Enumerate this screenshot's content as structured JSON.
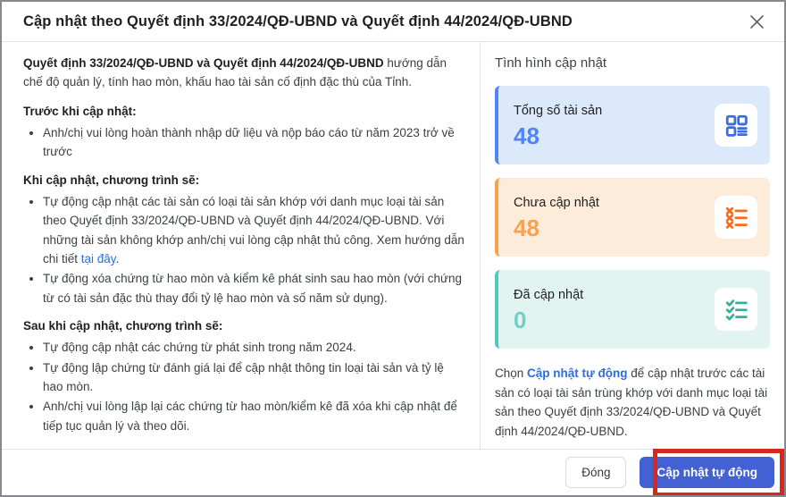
{
  "dialog": {
    "title": "Cập nhật theo Quyết định 33/2024/QĐ-UBND và Quyết định 44/2024/QĐ-UBND",
    "close_icon": "x-icon"
  },
  "content": {
    "intro": {
      "bold": "Quyết định 33/2024/QĐ-UBND và Quyết định 44/2024/QĐ-UBND",
      "rest": " hướng dẫn chế độ quản lý, tính hao mòn, khấu hao tài sản cố định đặc thù của Tỉnh."
    },
    "before_update": {
      "heading": "Trước khi cập nhật:",
      "bullet1": "Anh/chị vui lòng hoàn thành nhập dữ liệu và nộp báo cáo từ năm 2023 trở về trước"
    },
    "during_update": {
      "heading": "Khi cập nhật, chương trình sẽ:",
      "bullet1_pre": "Tự động cập nhật các tài sản có loại tài sản khớp với danh mục loại tài sản theo Quyết định 33/2024/QĐ-UBND và Quyết định 44/2024/QĐ-UBND. Với những tài sản không khớp anh/chị vui lòng cập nhật thủ công. Xem hướng dẫn chi tiết ",
      "bullet1_link": "tại đây",
      "bullet1_post": ".",
      "bullet2": "Tự động xóa chứng từ hao mòn và kiểm kê phát sinh sau hao mòn (với chứng từ có tài sản đặc thù thay đổi tỷ lệ hao mòn và số năm sử dụng)."
    },
    "after_update": {
      "heading": "Sau khi cập nhật, chương trình sẽ:",
      "bullet1": "Tự động cập nhật các chứng từ phát sinh trong năm 2024.",
      "bullet2": "Tự động lập chứng từ đánh giá lại để cập nhật thông tin loại tài sản và tỷ lệ hao mòn.",
      "bullet3": "Anh/chị vui lòng lập lại các chứng từ hao mòn/kiểm kê đã xóa khi cập nhật để tiếp tục quản lý và theo dõi."
    }
  },
  "status_panel": {
    "heading": "Tình hình cập nhật",
    "cards": [
      {
        "label": "Tổng số tài sản",
        "value": "48",
        "icon": "grid-list-icon",
        "bg": "#dce9fb",
        "accent": "#4f86f7",
        "value_color": "#4f86f7",
        "icon_color": "#3d6ce0"
      },
      {
        "label": "Chưa cập nhật",
        "value": "48",
        "icon": "list-x-icon",
        "bg": "#fdecd9",
        "accent": "#f6a250",
        "value_color": "#f6a250",
        "icon_color": "#f76c1c"
      },
      {
        "label": "Đã cập nhật",
        "value": "0",
        "icon": "list-check-icon",
        "bg": "#e2f4f2",
        "accent": "#57c7bd",
        "value_color": "#6fcfc6",
        "icon_color": "#2fb39a"
      }
    ],
    "note": {
      "pre": "Chọn ",
      "link": "Cập nhật tự động",
      "post": " để cập nhật trước các tài sản có loại tài sản trùng khớp với danh mục loại tài sản theo Quyết định 33/2024/QĐ-UBND và Quyết định 44/2024/QĐ-UBND."
    }
  },
  "footer": {
    "close_label": "Đóng",
    "primary_label": "Cập nhật tự động"
  },
  "colors": {
    "link": "#2b6de8",
    "primary_button": "#4361d2",
    "annotation_red": "#d6281e",
    "dialog_border": "#85898f"
  }
}
